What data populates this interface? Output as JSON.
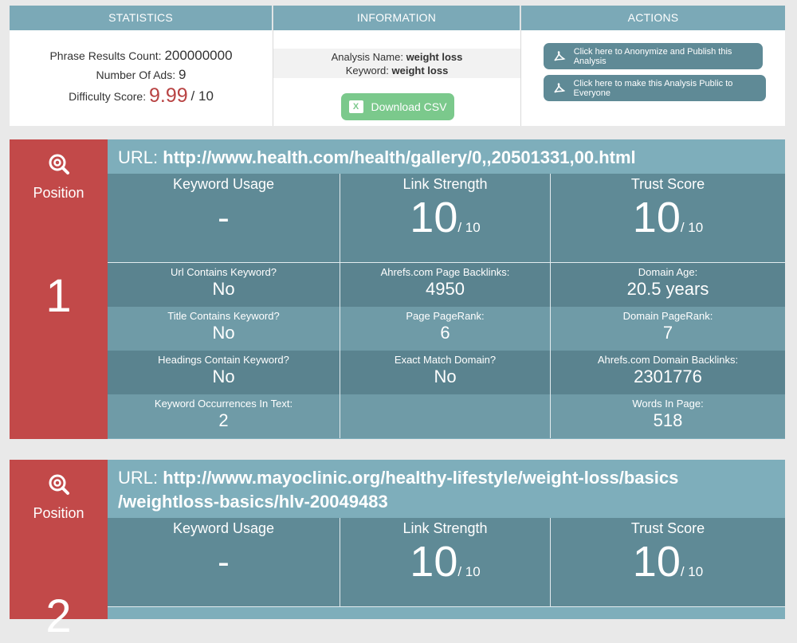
{
  "summary": {
    "statistics": {
      "header": "STATISTICS",
      "phrase_results_label": "Phrase Results Count:",
      "phrase_results_value": "200000000",
      "ads_label": "Number Of Ads:",
      "ads_value": "9",
      "difficulty_label": "Difficulty Score:",
      "difficulty_value": "9.99",
      "difficulty_of": "/ 10"
    },
    "information": {
      "header": "INFORMATION",
      "analysis_name_label": "Analysis Name:",
      "analysis_name_value": "weight loss",
      "keyword_label": "Keyword:",
      "keyword_value": "weight loss",
      "download_label": "Download CSV"
    },
    "actions": {
      "header": "ACTIONS",
      "anonymize_label": "Click here to Anonymize and Publish this Analysis",
      "public_label": "Click here to make this Analysis Public to Everyone"
    }
  },
  "results": [
    {
      "position_label": "Position",
      "position": "1",
      "url_label": "URL:",
      "url": "http://www.health.com/health/gallery/0,,20501331,00.html",
      "keyword_usage_title": "Keyword Usage",
      "keyword_usage_value": "-",
      "link_strength_title": "Link Strength",
      "link_strength_value": "10",
      "link_strength_of": "/ 10",
      "trust_score_title": "Trust Score",
      "trust_score_value": "10",
      "trust_score_of": "/ 10",
      "metrics": [
        [
          {
            "label": "Url Contains Keyword?",
            "value": "No"
          },
          {
            "label": "Ahrefs.com Page Backlinks:",
            "value": "4950"
          },
          {
            "label": "Domain Age:",
            "value": "20.5 years"
          }
        ],
        [
          {
            "label": "Title Contains Keyword?",
            "value": "No"
          },
          {
            "label": "Page PageRank:",
            "value": "6"
          },
          {
            "label": "Domain PageRank:",
            "value": "7"
          }
        ],
        [
          {
            "label": "Headings Contain Keyword?",
            "value": "No"
          },
          {
            "label": "Exact Match Domain?",
            "value": "No"
          },
          {
            "label": "Ahrefs.com Domain Backlinks:",
            "value": "2301776"
          }
        ],
        [
          {
            "label": "Keyword Occurrences In Text:",
            "value": "2"
          },
          {
            "label": "",
            "value": ""
          },
          {
            "label": "Words In Page:",
            "value": "518"
          }
        ]
      ]
    },
    {
      "position_label": "Position",
      "position": "2",
      "url_label": "URL:",
      "url_line1": "http://www.mayoclinic.org/healthy-lifestyle/weight-loss/basics",
      "url_line2": "/weightloss-basics/hlv-20049483",
      "keyword_usage_title": "Keyword Usage",
      "keyword_usage_value": "-",
      "link_strength_title": "Link Strength",
      "link_strength_value": "10",
      "link_strength_of": "/ 10",
      "trust_score_title": "Trust Score",
      "trust_score_value": "10",
      "trust_score_of": "/ 10"
    }
  ],
  "icons": {
    "position": "target-search-icon",
    "csv": "excel-icon",
    "actions": "pdf-icon"
  },
  "colors": {
    "header": "#7ba9b7",
    "position_red": "#c24949",
    "csv_green": "#7bc98c",
    "action_btn": "#5f8a96",
    "score_red": "#b84343"
  }
}
